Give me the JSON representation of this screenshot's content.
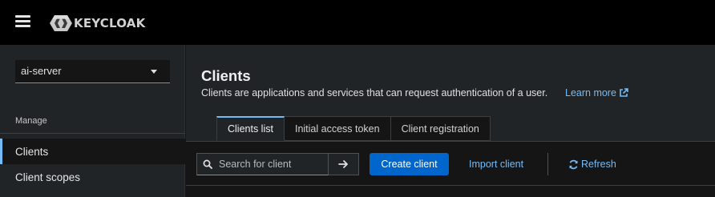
{
  "masthead": {
    "logo_text": "KEYCLOAK",
    "menu_icon": "hamburger-menu-icon",
    "logo_icon": "keycloak-logo-icon"
  },
  "sidebar": {
    "realm": "ai-server",
    "section": "Manage",
    "items": [
      {
        "label": "Clients",
        "active": true
      },
      {
        "label": "Client scopes",
        "active": false
      }
    ]
  },
  "main": {
    "title": "Clients",
    "description": "Clients are applications and services that can request authentication of a user.",
    "learn_more": "Learn more",
    "tabs": [
      {
        "label": "Clients list",
        "active": true
      },
      {
        "label": "Initial access token",
        "active": false
      },
      {
        "label": "Client registration",
        "active": false
      }
    ],
    "toolbar": {
      "search_placeholder": "Search for client",
      "create_label": "Create client",
      "import_label": "Import client",
      "refresh_label": "Refresh"
    }
  },
  "colors": {
    "masthead": "#000000",
    "sidebar": "#212427",
    "accent": "#73bcf7",
    "primary_button": "#0066cc"
  }
}
